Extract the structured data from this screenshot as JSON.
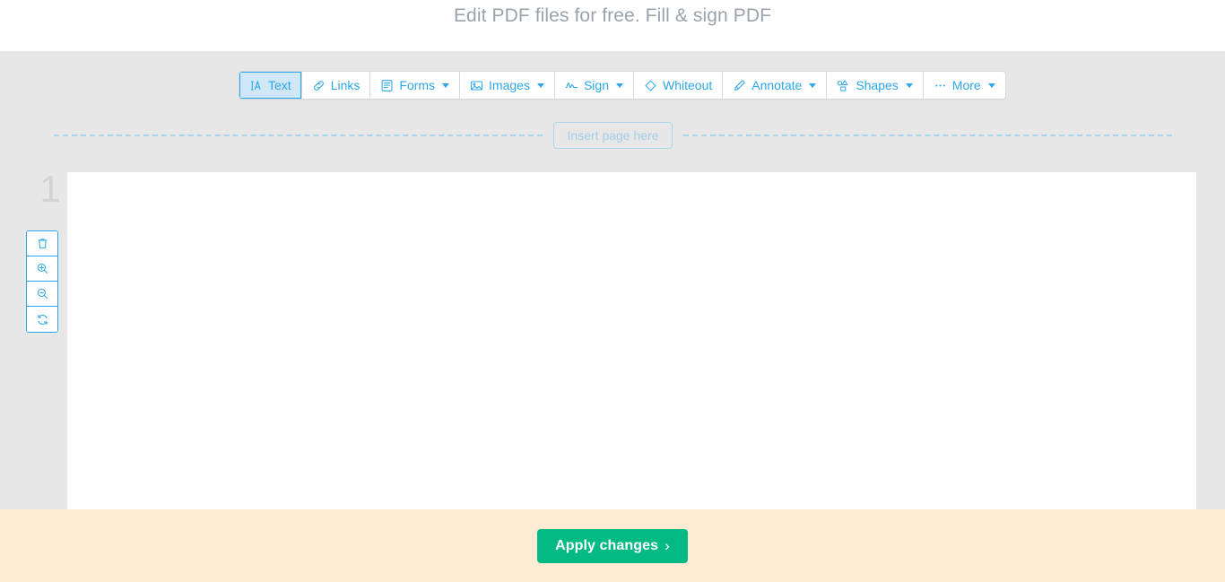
{
  "header": {
    "subtitle": "Edit PDF files for free. Fill & sign PDF"
  },
  "toolbar": {
    "items": [
      {
        "label": "Text",
        "icon": "text-cursor-icon",
        "active": true,
        "caret": false
      },
      {
        "label": "Links",
        "icon": "link-icon",
        "active": false,
        "caret": false
      },
      {
        "label": "Forms",
        "icon": "form-icon",
        "active": false,
        "caret": true
      },
      {
        "label": "Images",
        "icon": "image-icon",
        "active": false,
        "caret": true
      },
      {
        "label": "Sign",
        "icon": "signature-icon",
        "active": false,
        "caret": true
      },
      {
        "label": "Whiteout",
        "icon": "eraser-icon",
        "active": false,
        "caret": false
      },
      {
        "label": "Annotate",
        "icon": "pen-icon",
        "active": false,
        "caret": true
      },
      {
        "label": "Shapes",
        "icon": "shapes-icon",
        "active": false,
        "caret": true
      },
      {
        "label": "More",
        "icon": "ellipsis-icon",
        "active": false,
        "caret": true
      }
    ]
  },
  "insert": {
    "button_label": "Insert page here"
  },
  "document": {
    "page_number": "1"
  },
  "page_tools": {
    "items": [
      {
        "name": "delete-page-button",
        "icon": "trash-icon"
      },
      {
        "name": "zoom-in-page-button",
        "icon": "zoom-in-icon"
      },
      {
        "name": "zoom-out-page-button",
        "icon": "zoom-out-icon"
      },
      {
        "name": "rotate-page-button",
        "icon": "rotate-icon"
      }
    ]
  },
  "footer": {
    "apply_label": "Apply changes",
    "apply_chevron": "›"
  },
  "colors": {
    "accent_blue": "#2ba6e8",
    "active_tab_bg": "#cfe7f7",
    "workspace_gray": "#e7e7e8",
    "footer_peach": "#fdebd3",
    "apply_green": "#04ba84",
    "subtitle_gray": "#9aa3ab",
    "dashed_blue": "#a8d4ee"
  }
}
